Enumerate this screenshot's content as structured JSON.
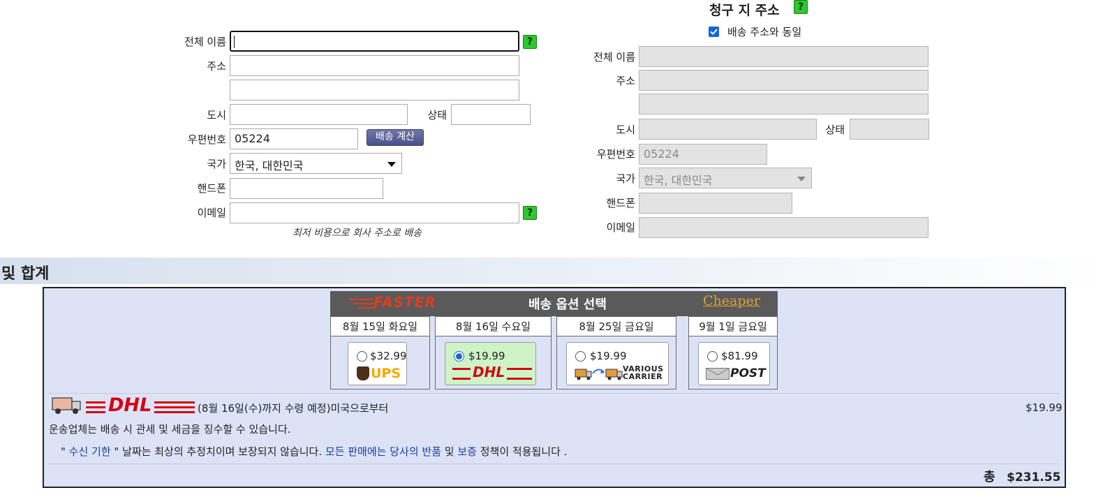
{
  "shipping": {
    "labels": {
      "full_name": "전체 이름",
      "address": "주소",
      "city": "도시",
      "state": "상태",
      "zip": "우편번호",
      "country": "국가",
      "phone": "핸드폰",
      "email": "이메일"
    },
    "values": {
      "full_name": "",
      "address1": "",
      "address2": "",
      "city": "",
      "state": "",
      "zip": "05224",
      "country": "한국, 대한민국",
      "phone": "",
      "email": ""
    },
    "calc_button": "배송 계산",
    "help_icon": "?",
    "note": "최저 비용으로 회사 주소로 배송"
  },
  "billing": {
    "title": "청구 지 주소",
    "same_as_shipping_label": "배송 주소와 동일",
    "same_as_shipping_checked": true,
    "labels": {
      "full_name": "전체 이름",
      "address": "주소",
      "city": "도시",
      "state": "상태",
      "zip": "우편번호",
      "country": "국가",
      "phone": "핸드폰",
      "email": "이메일"
    },
    "values": {
      "zip": "05224",
      "country": "한국, 대한민국"
    }
  },
  "summary": {
    "section_title": "및 합계",
    "shipping_options": {
      "title": "배송 옵션 선택",
      "faster": "FASTER",
      "cheaper": "Cheaper",
      "options": [
        {
          "date": "8월 15일 화요일",
          "price": "$32.99",
          "carrier": "UPS",
          "selected": false
        },
        {
          "date": "8월 16일 수요일",
          "price": "$19.99",
          "carrier": "DHL",
          "selected": true
        },
        {
          "date": "8월 25일 금요일",
          "price": "$19.99",
          "carrier": "VARIOUS CARRIER",
          "selected": false
        },
        {
          "date": "9월 1일 금요일",
          "price": "$81.99",
          "carrier": "POST",
          "selected": false
        }
      ]
    },
    "selected_carrier_logo": "DHL",
    "delivery_text": "(8월 16일(수)까지 수령 예정)미국으로부터",
    "shipping_cost": "$19.99",
    "duties_note": "운송업체는 배송 시 관세 및 세금을 징수할 수 있습니다.",
    "disclaimer": {
      "quote_open": "\" ",
      "link_receive_by": "수신 기한",
      "quote_close": " \" 날짜는 최상의 추정치이며 보장되지 않습니다. ",
      "link_all_sales": "모든 판매에는 당사의 반품",
      "and": " 및 ",
      "link_warranty": "보증",
      "tail": " 정책이 적용됩니다 ."
    },
    "total_label": "총",
    "total_value": "$231.55"
  },
  "colors": {
    "help_green": "#2ec82e",
    "panel_bg": "#dde3f7",
    "dhl_red": "#d40511",
    "ups_gold": "#f2a900",
    "link_blue": "#1a3c9c"
  }
}
